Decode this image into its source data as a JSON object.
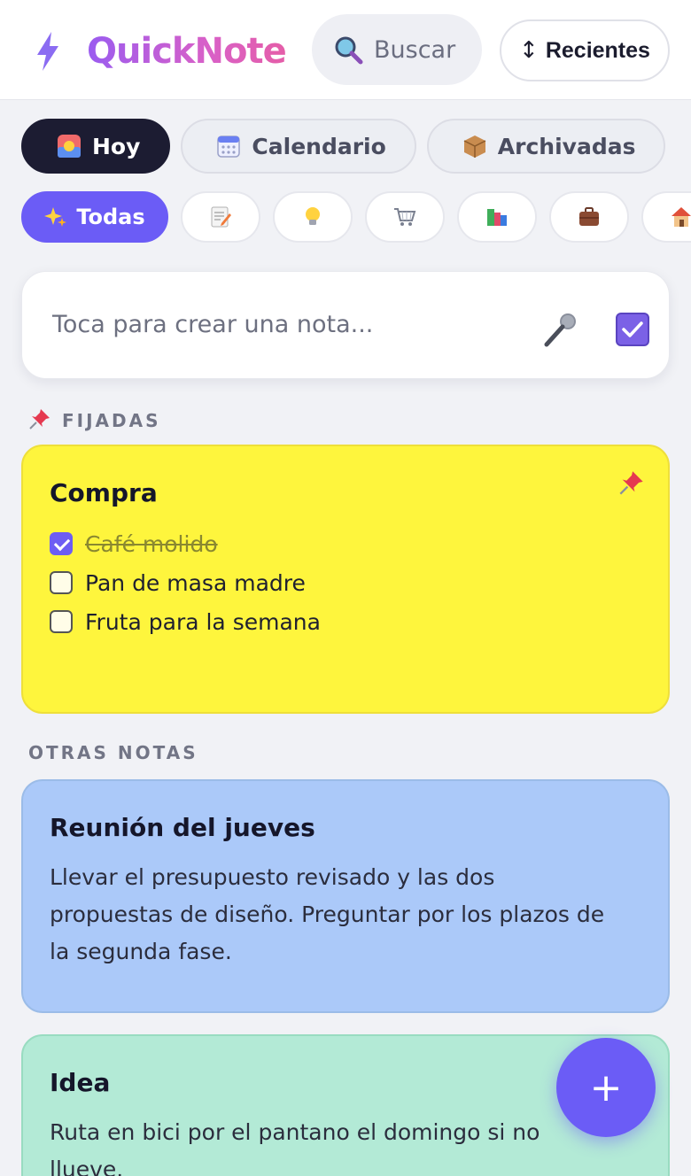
{
  "app": {
    "title": "QuickNote"
  },
  "search": {
    "placeholder": "Buscar"
  },
  "sort": {
    "label": "Recientes"
  },
  "views": [
    {
      "label": "Hoy",
      "icon": "sunrise-calendar-icon",
      "active": true
    },
    {
      "label": "Calendario",
      "icon": "calendar-icon"
    },
    {
      "label": "Archivadas",
      "icon": "package-icon"
    }
  ],
  "categories": [
    {
      "label": "Todas",
      "icon": "sparkles-icon",
      "active": true
    },
    {
      "icon": "memo-icon"
    },
    {
      "icon": "lightbulb-icon"
    },
    {
      "icon": "shopping-cart-icon"
    },
    {
      "icon": "books-icon"
    },
    {
      "icon": "briefcase-icon"
    },
    {
      "icon": "house-icon"
    }
  ],
  "composer": {
    "placeholder": "Toca para crear una nota..."
  },
  "sections": {
    "pinned": "FIJADAS",
    "others": "OTRAS NOTAS"
  },
  "notes": [
    {
      "title": "Compra",
      "color": "#fef53d",
      "pinned": true,
      "items": [
        {
          "text": "Café molido",
          "checked": true
        },
        {
          "text": "Pan de masa madre",
          "checked": false
        },
        {
          "text": "Fruta para la semana",
          "checked": false
        }
      ]
    },
    {
      "title": "Reunión del jueves",
      "color": "#abc9f9",
      "body": "Llevar el presupuesto revisado y las dos propuestas de diseño. Preguntar por los plazos de la segunda fase."
    },
    {
      "title": "Idea",
      "color": "#b3ead6",
      "body": "Ruta en bici por el pantano el domingo si no llueve."
    }
  ],
  "fab": {
    "label": "+"
  },
  "colors": {
    "accent": "#6b5cf6",
    "dark": "#1c1c32"
  }
}
